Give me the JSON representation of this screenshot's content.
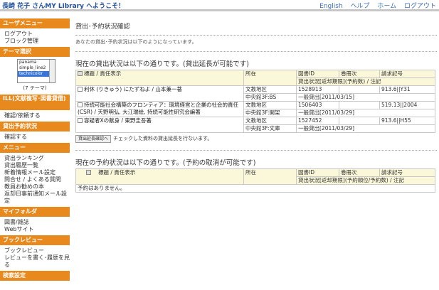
{
  "header": {
    "site_title": "長崎 花子 さんMY Library へようこそ！",
    "links": [
      "English",
      "ヘルプ",
      "ホーム",
      "ログアウト"
    ]
  },
  "sidebar": {
    "user_menu": {
      "heading": "ユーザメニュー",
      "items": [
        "ログアウト",
        "ブロック管理"
      ]
    },
    "theme": {
      "heading": "テーマ選択",
      "options": [
        "panama",
        "simple_line2",
        "technicolor"
      ],
      "selected": "technicolor",
      "count": "(7 テーマ)"
    },
    "ill": {
      "heading": "ILL(文献複写･図書貸借)",
      "items": [
        "確認/依頼する"
      ]
    },
    "loan": {
      "heading": "貸出予約状況",
      "items": [
        "確認する"
      ]
    },
    "menu": {
      "heading": "メニュー",
      "items": [
        "貸出ランキング",
        "貸出履歴一覧",
        "新着情報メール設定",
        "問合せ / よくある質問",
        "教員お勧めの本",
        "返却日事前通知メール設定"
      ]
    },
    "myfolder": {
      "heading": "マイフォルダ",
      "items": [
        "図書/雑誌",
        "Webサイト"
      ]
    },
    "bookreview": {
      "heading": "ブックレビュー",
      "items": [
        "ブックレビュー",
        "レビューを書く･履歴を見る"
      ]
    },
    "more": {
      "heading": "検索設定"
    }
  },
  "main": {
    "title": "貸出･予約状況確認",
    "note": "あなたの貸出･予約状況は以下のようになっています。",
    "loans": {
      "heading": "現在の貸出状況は以下の通りです。(貸出延長が可能です)",
      "col_title": "標題 / 責任表示",
      "col_location": "所在",
      "col_id": "図書ID",
      "col_vol": "巻冊次",
      "col_call": "請求記号",
      "col_status": "貸出状況[返却期限](予約数) / 注記",
      "rows": [
        {
          "title": "利休 (りきゅう) にたずねよ / 山本兼一著",
          "loc1": "文教地区",
          "loc2": "中央館3F:BS",
          "id": "1528913",
          "vol": "",
          "call": "913.6||Y31",
          "status": "一般貸出[2011/03/15]"
        },
        {
          "title": "持続可能社会構築のフロンティア：環境経営と企業の社会的責任(CSR) / 天野明弘, 大江瑞絵, 持続可能性研究会編著",
          "loc1": "文教地区",
          "loc2": "中央館3F:開架",
          "id": "1506403",
          "vol": "",
          "call": "519.13||2004",
          "status": "一般貸出[2011/03/29]"
        },
        {
          "title": "容疑者Xの献身 / 東野圭吾著",
          "loc1": "文教地区",
          "loc2": "中央館3F:文庫",
          "id": "1527452",
          "vol": "",
          "call": "913.6||H55",
          "status": "一般貸出[2011/03/29]"
        }
      ],
      "extend_button": "貸出延長確認へ",
      "extend_note": "チェックした資料の貸出延長を行ないます。"
    },
    "reservations": {
      "heading": "現在の予約状況は以下の通りです。(予約の取消が可能です)",
      "col_title": "標題 / 責任表示",
      "col_location": "所在",
      "col_id": "図書ID",
      "col_vol": "巻冊次",
      "col_call": "請求記号",
      "col_status": "貸出状況[返却期限](予約順位/予約数) / 注記",
      "empty": "予約はありません。"
    }
  }
}
